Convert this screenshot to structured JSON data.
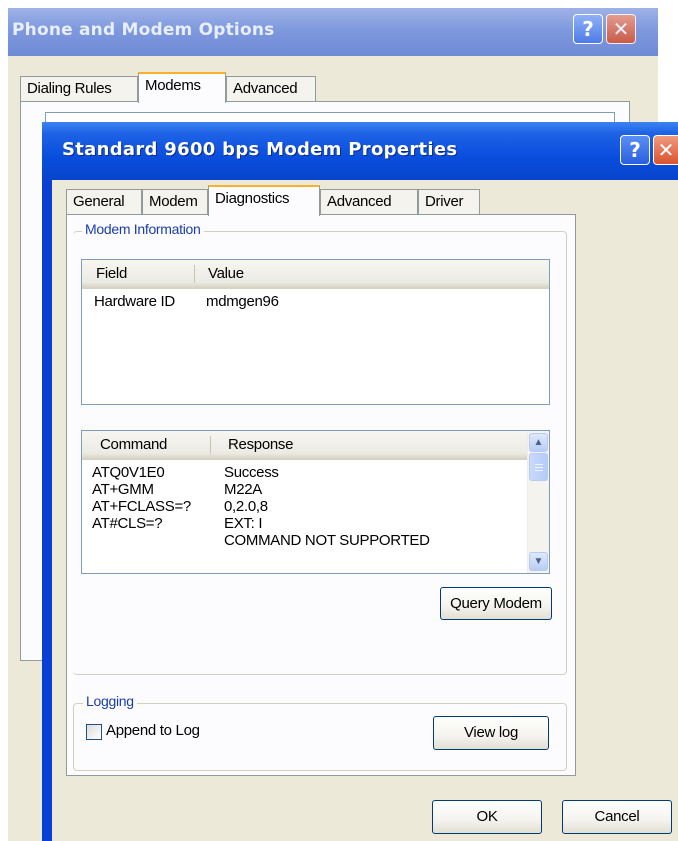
{
  "back_window": {
    "title": "Phone and Modem Options",
    "help_glyph": "?",
    "close_glyph": "✕",
    "tabs": [
      {
        "label": "Dialing Rules",
        "active": false
      },
      {
        "label": "Modems",
        "active": true
      },
      {
        "label": "Advanced",
        "active": false
      }
    ]
  },
  "front_window": {
    "title": "Standard  9600 bps Modem Properties",
    "help_glyph": "?",
    "close_glyph": "✕",
    "tabs": [
      {
        "label": "General",
        "active": false
      },
      {
        "label": "Modem",
        "active": false
      },
      {
        "label": "Diagnostics",
        "active": true
      },
      {
        "label": "Advanced",
        "active": false
      },
      {
        "label": "Driver",
        "active": false
      }
    ],
    "modem_information": {
      "group_label": "Modem Information",
      "info_table": {
        "columns": [
          "Field",
          "Value"
        ],
        "rows": [
          [
            "Hardware ID",
            "mdmgen96"
          ]
        ]
      },
      "command_table": {
        "columns": [
          "Command",
          "Response"
        ],
        "rows": [
          [
            "ATQ0V1E0",
            "Success"
          ],
          [
            "AT+GMM",
            "M22A"
          ],
          [
            "AT+FCLASS=?",
            "0,2.0,8"
          ],
          [
            "AT#CLS=?",
            "EXT: I"
          ],
          [
            "",
            "COMMAND NOT SUPPORTED"
          ]
        ]
      },
      "query_button": "Query Modem"
    },
    "logging": {
      "group_label": "Logging",
      "append_checkbox_label": "Append to Log",
      "append_checked": false,
      "view_log_button": "View log"
    },
    "ok_button": "OK",
    "cancel_button": "Cancel"
  },
  "colors": {
    "xp_blue_title": "#0a4ede",
    "inactive_title": "#7f99de",
    "dialog_face": "#ece9d8",
    "tab_highlight": "#f7b12c",
    "group_label_text": "#1a3ca8"
  }
}
